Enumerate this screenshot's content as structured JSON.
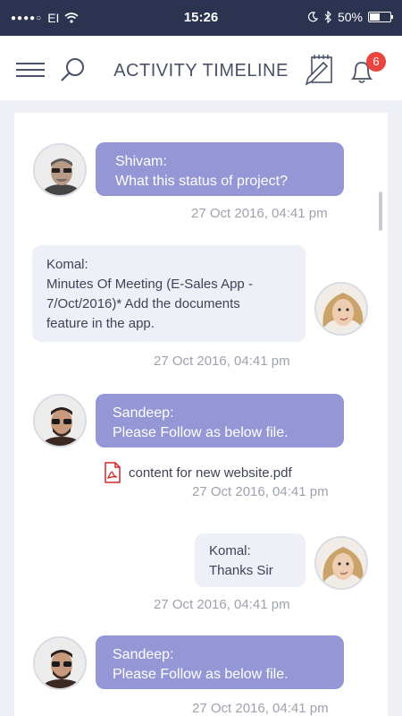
{
  "status_bar": {
    "carrier": "EI",
    "time": "15:26",
    "battery": "50%"
  },
  "header": {
    "title": "ACTIVITY TIMELINE",
    "notification_count": "6"
  },
  "messages": [
    {
      "author": "Shivam:",
      "text": "What this status of project?",
      "timestamp": "27 Oct 2016, 04:41 pm"
    },
    {
      "author": "Komal:",
      "line1": "Minutes Of Meeting (E-Sales App -",
      "line2": "7/Oct/2016)* Add the documents",
      "line3": "feature in the app.",
      "timestamp": "27 Oct 2016, 04:41 pm"
    },
    {
      "author": "Sandeep:",
      "text": "Please Follow as below file.",
      "attachment": "content for new website.pdf",
      "timestamp": "27 Oct 2016, 04:41 pm"
    },
    {
      "author": "Komal:",
      "text": "Thanks Sir",
      "timestamp": "27 Oct 2016, 04:41 pm"
    },
    {
      "author": "Sandeep:",
      "text": "Please Follow as below file.",
      "timestamp": "27 Oct 2016, 04:41 pm"
    }
  ],
  "icons": {
    "menu": "hamburger-menu-icon",
    "search": "search-icon",
    "edit": "edit-note-icon",
    "bell": "bell-icon",
    "pdf": "pdf-file-icon"
  },
  "colors": {
    "status_bar": "#2b3350",
    "bubble_sent": "#9596d5",
    "bubble_received": "#eef0f7",
    "badge": "#e9453f"
  }
}
